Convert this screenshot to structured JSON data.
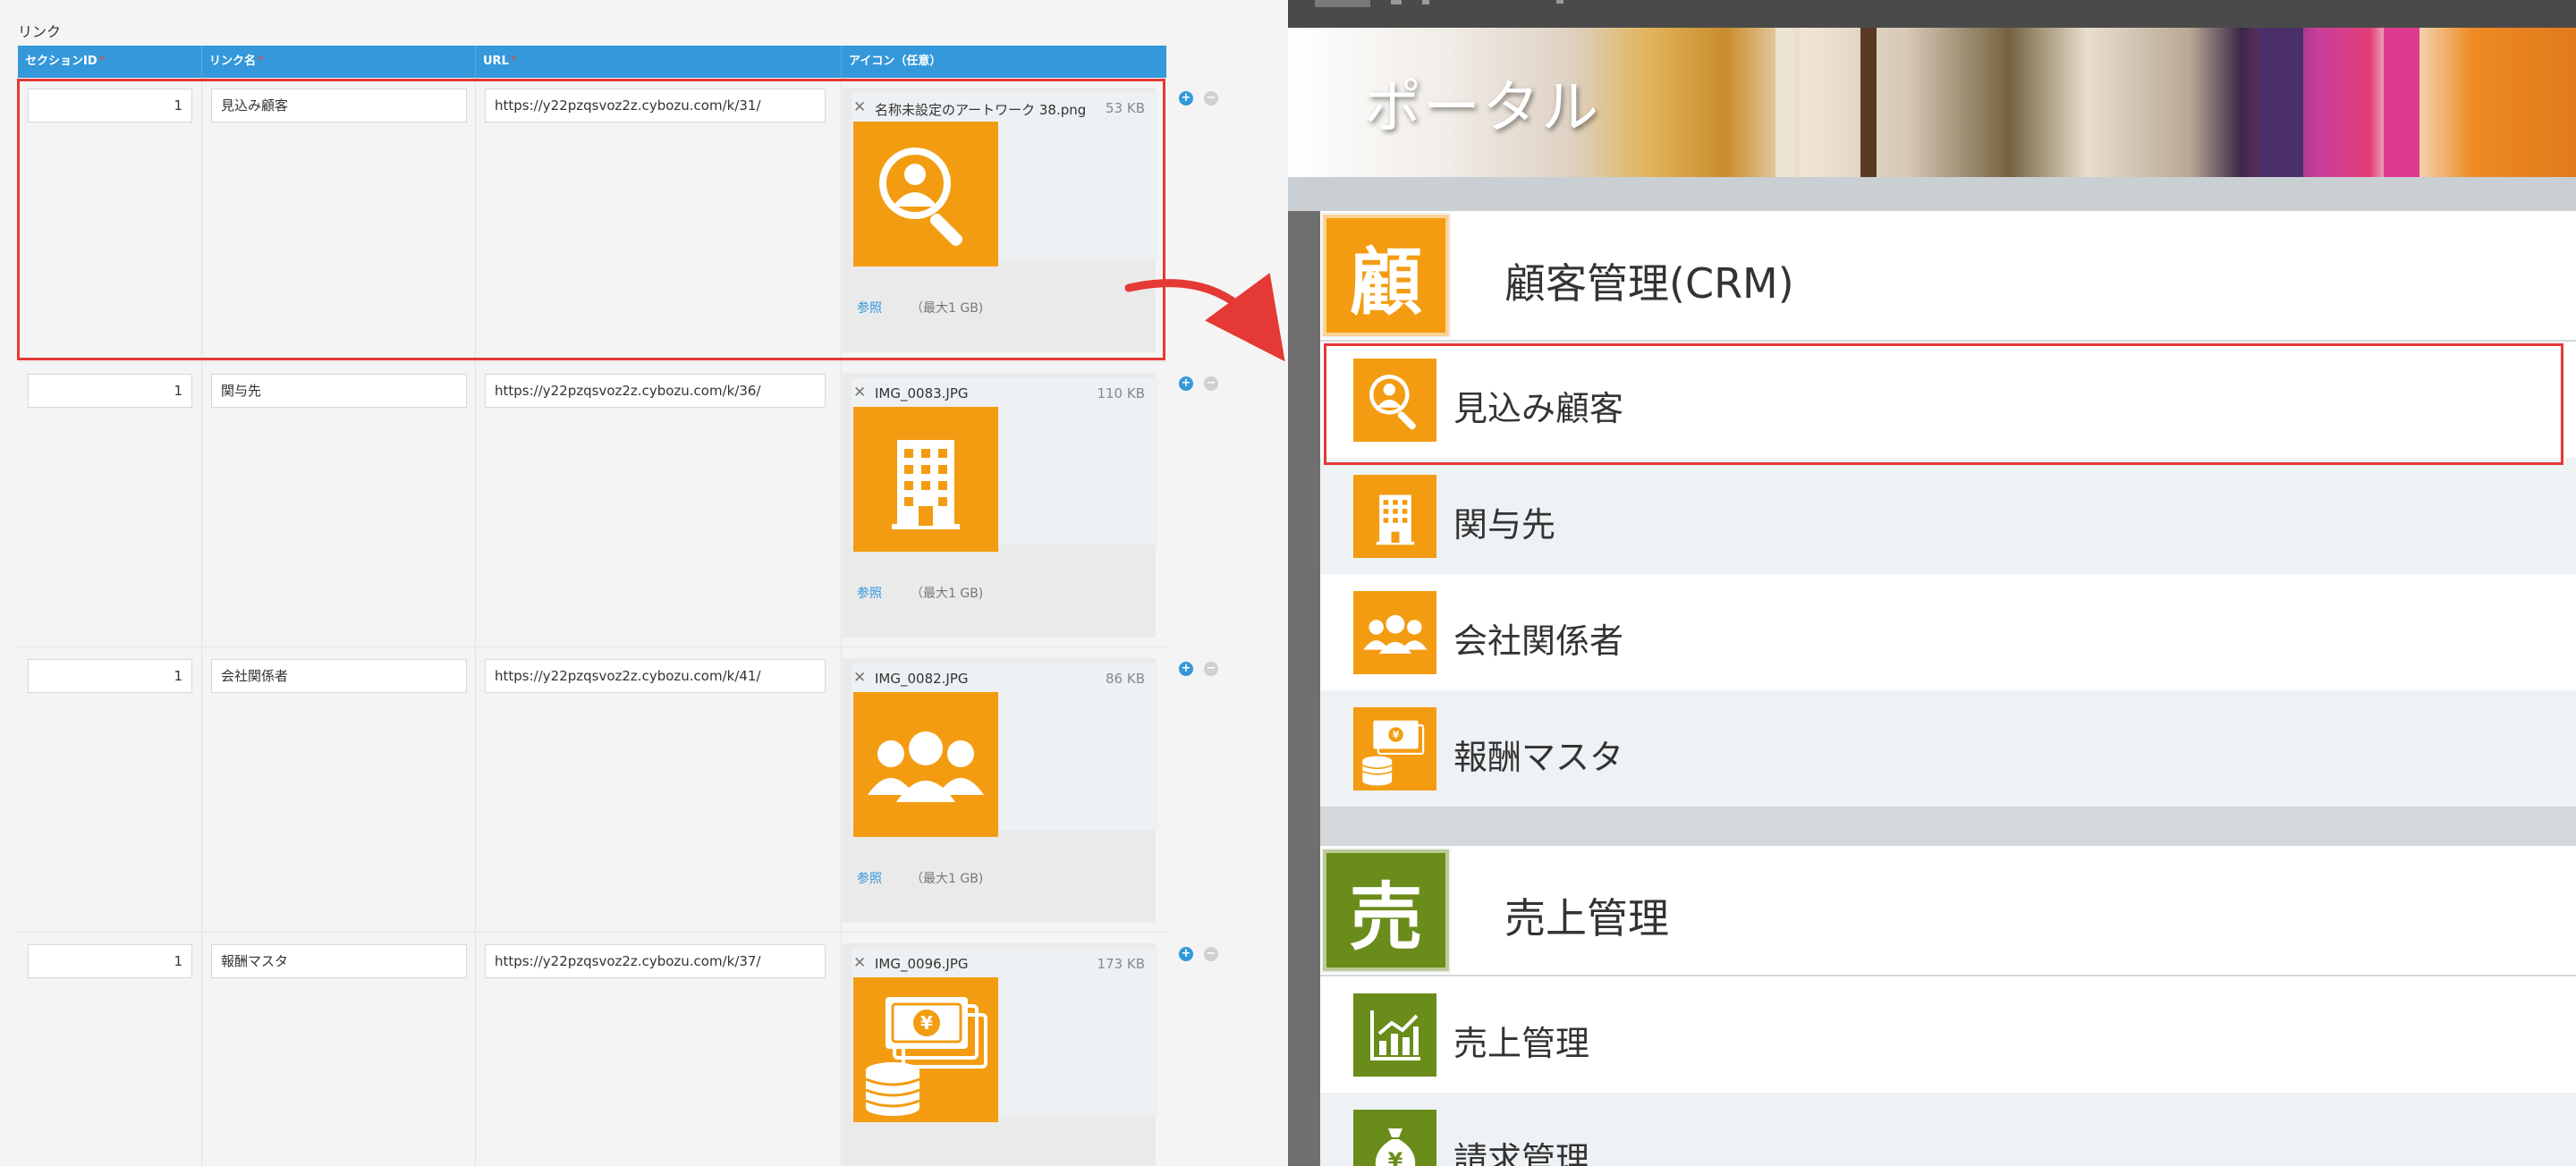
{
  "left_panel": {
    "section_label": "リンク",
    "columns": [
      {
        "label": "セクションID",
        "required": true
      },
      {
        "label": "リンク名",
        "required": true
      },
      {
        "label": "URL",
        "required": true
      },
      {
        "label": "アイコン（任意）",
        "required": false
      }
    ],
    "required_mark": "*",
    "rows": [
      {
        "section_id": "1",
        "name": "見込み顧客",
        "url": "https://y22pzqsvoz2z.cybozu.com/k/31/",
        "file_name": "名称未設定のアートワーク 38.png",
        "file_size": "53 KB",
        "icon": "search-person-icon",
        "browse": "参照",
        "max": "（最大1 GB)"
      },
      {
        "section_id": "1",
        "name": "関与先",
        "url": "https://y22pzqsvoz2z.cybozu.com/k/36/",
        "file_name": "IMG_0083.JPG",
        "file_size": "110 KB",
        "icon": "building-icon",
        "browse": "参照",
        "max": "（最大1 GB)"
      },
      {
        "section_id": "1",
        "name": "会社関係者",
        "url": "https://y22pzqsvoz2z.cybozu.com/k/41/",
        "file_name": "IMG_0082.JPG",
        "file_size": "86 KB",
        "icon": "people-group-icon",
        "browse": "参照",
        "max": "（最大1 GB)"
      },
      {
        "section_id": "1",
        "name": "報酬マスタ",
        "url": "https://y22pzqsvoz2z.cybozu.com/k/37/",
        "file_name": "IMG_0096.JPG",
        "file_size": "173 KB",
        "icon": "yen-money-icon",
        "browse": "参照",
        "max": "（最大1 GB)"
      }
    ],
    "remove_file_glyph": "✕",
    "add_glyph": "+",
    "remove_glyph": "−"
  },
  "right_panel": {
    "portal_title": "ポータル",
    "categories": [
      {
        "badge": "顧",
        "title": "顧客管理(CRM)",
        "color": "#f39c12",
        "items": [
          {
            "label": "見込み顧客",
            "icon": "search-person-icon"
          },
          {
            "label": "関与先",
            "icon": "building-icon"
          },
          {
            "label": "会社関係者",
            "icon": "people-group-icon"
          },
          {
            "label": "報酬マスタ",
            "icon": "yen-money-icon"
          }
        ]
      },
      {
        "badge": "売",
        "title": "売上管理",
        "color": "#6a8c1a",
        "items": [
          {
            "label": "売上管理",
            "icon": "chart-icon"
          },
          {
            "label": "請求管理",
            "icon": "money-bag-icon"
          }
        ]
      }
    ]
  },
  "colors": {
    "header_blue": "#3498db",
    "highlight_red": "#e53935",
    "crm_orange": "#f39c12",
    "sales_green": "#6a8c1a"
  }
}
